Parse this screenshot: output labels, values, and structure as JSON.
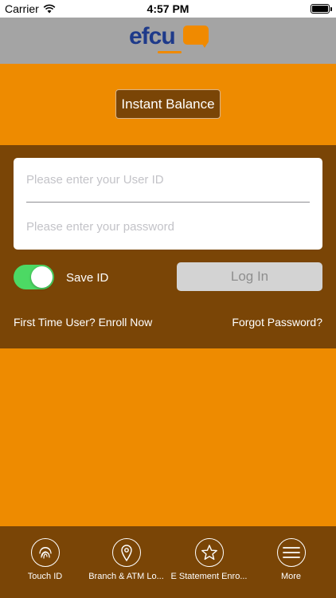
{
  "status_bar": {
    "carrier": "Carrier",
    "time": "4:57 PM"
  },
  "header": {
    "logo_text": "efcu"
  },
  "instant_balance": {
    "label": "Instant Balance"
  },
  "login": {
    "user_id_placeholder": "Please enter your User ID",
    "password_placeholder": "Please enter your password",
    "save_id_label": "Save ID",
    "save_id_checked": true,
    "login_label": "Log In",
    "enroll_link": "First Time User? Enroll Now",
    "forgot_link": "Forgot Password?"
  },
  "tab_bar": {
    "items": [
      {
        "label": "Touch ID",
        "icon": "fingerprint-icon"
      },
      {
        "label": "Branch & ATM Lo...",
        "icon": "location-pin-icon"
      },
      {
        "label": "E Statement Enro...",
        "icon": "star-icon"
      },
      {
        "label": "More",
        "icon": "menu-icon"
      }
    ]
  },
  "colors": {
    "orange": "#ee8b00",
    "brown": "#7a4506",
    "header_gray": "#a4a4a4",
    "toggle_green": "#4cd964",
    "logo_blue": "#1e3a8a"
  }
}
